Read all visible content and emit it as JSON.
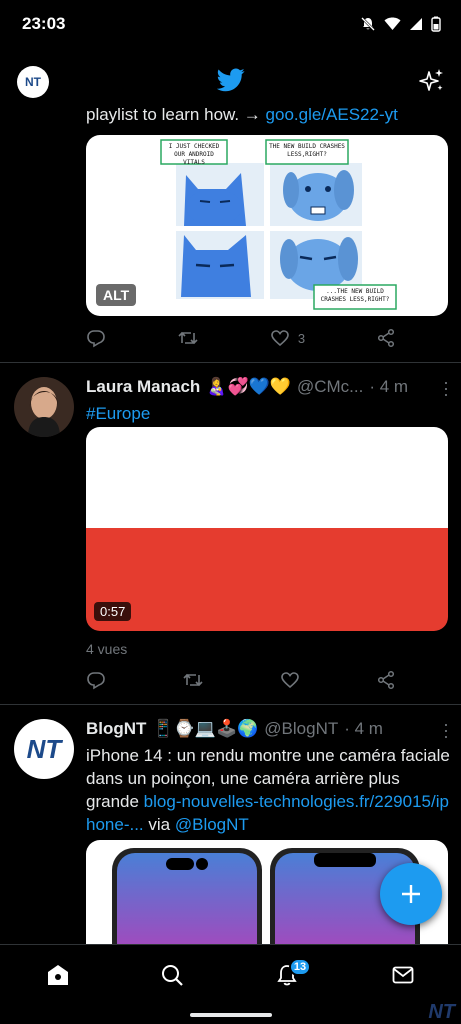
{
  "status": {
    "time": "23:03"
  },
  "topbar": {
    "avatar_text": "NT"
  },
  "tweet1": {
    "text_prefix": "playlist to learn how. → ",
    "link": "goo.gle/AES22-yt",
    "meme_captions": [
      "I JUST CHECKED OUR ANDROID VITALS",
      "THE NEW BUILD CRASHES LESS,RIGHT?",
      "...THE NEW BUILD CRASHES LESS,RIGHT?"
    ],
    "alt_label": "ALT",
    "like_count": "3"
  },
  "tweet2": {
    "name": "Laura Manach",
    "emojis": "👩‍🍼💞💙💛",
    "handle": "@CMc...",
    "time": "· 4 m",
    "hashtag": "#Europe",
    "duration": "0:57",
    "views": "4 vues"
  },
  "tweet3": {
    "name": "BlogNT",
    "emojis": "📱⌚💻🕹️🌍",
    "handle": "@BlogNT",
    "time": "· 4 m",
    "avatar_text": "NT",
    "text": "iPhone 14 : un rendu montre une caméra faciale dans un poinçon, une caméra arrière plus grande ",
    "link": "blog-nouvelles-technologies.fr/229015/iphone-...",
    "via": " via ",
    "mention": "@BlogNT"
  },
  "nav": {
    "notifications_badge": "13"
  },
  "watermark": "NT",
  "colors": {
    "accent": "#1d9bf0",
    "background": "#000000",
    "divider": "#2f3336",
    "muted": "#71767b"
  },
  "icons": [
    "twitter-bird-icon",
    "sparkle-icon",
    "reply-icon",
    "retweet-icon",
    "like-icon",
    "share-icon",
    "more-icon",
    "compose-icon",
    "home-icon",
    "search-icon",
    "bell-icon",
    "mail-icon"
  ]
}
